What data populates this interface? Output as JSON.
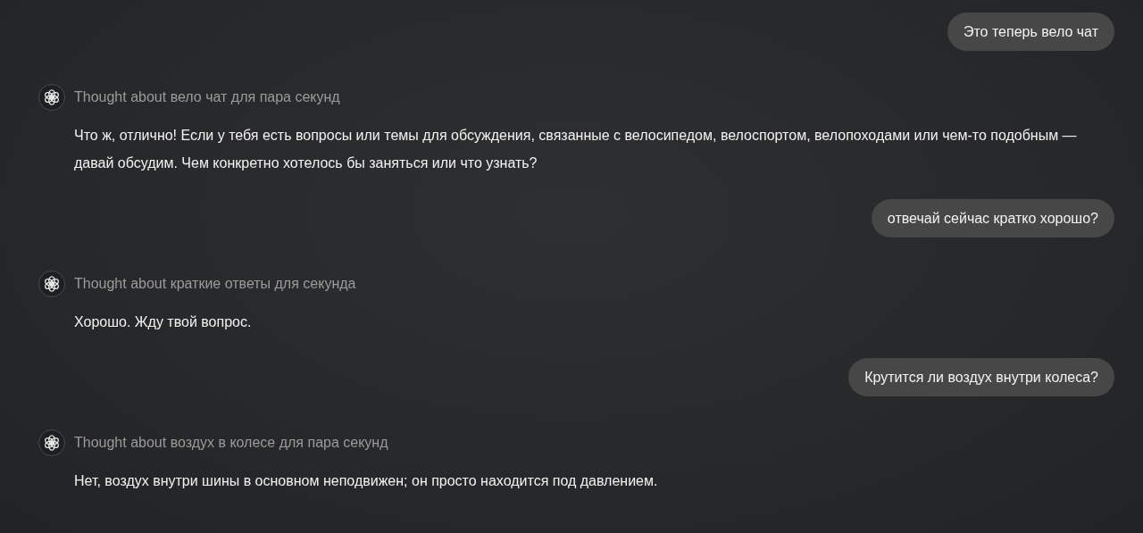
{
  "messages": [
    {
      "kind": "user",
      "text": "Это теперь вело чат"
    },
    {
      "kind": "assistant",
      "thought": "Thought about вело чат для пара секунд",
      "text": "Что ж, отлично! Если у тебя есть вопросы или темы для обсуждения, связанные с велосипедом, велоспортом, велопоходами или чем-то подобным — давай обсудим. Чем конкретно хотелось бы заняться или что узнать?"
    },
    {
      "kind": "user",
      "text": "отвечай сейчас кратко хорошо?"
    },
    {
      "kind": "assistant",
      "thought": "Thought about краткие ответы для секунда",
      "text": "Хорошо. Жду твой вопрос."
    },
    {
      "kind": "user",
      "text": "Крутится ли воздух внутри колеса?"
    },
    {
      "kind": "assistant",
      "thought": "Thought about воздух в колесе для пара секунд",
      "text": "Нет, воздух внутри шины в основном неподвижен; он просто находится под давлением."
    }
  ]
}
